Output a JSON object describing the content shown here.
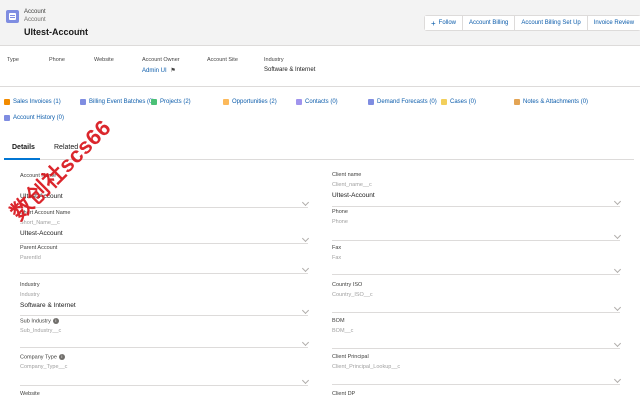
{
  "header": {
    "object_type": "Account",
    "object_type_sub": "Account",
    "record_name": "UItest-Account",
    "hierarchy_icon": "hierarchy-icon",
    "buttons": {
      "follow": "Follow",
      "account_billing": "Account Billing",
      "account_billing_setup": "Account Billing Set Up",
      "invoice_review": "Invoice Review"
    }
  },
  "highlights": {
    "type_label": "Type",
    "phone_label": "Phone",
    "website_label": "Website",
    "owner_label": "Account Owner",
    "owner_value": "Admin UI",
    "site_label": "Account Site",
    "industry_label": "Industry",
    "industry_value": "Software & Internet"
  },
  "related_links": [
    {
      "label": "Sales Invoices (1)",
      "color": "#f28b00"
    },
    {
      "label": "Billing Event Batches (0)",
      "color": "#7f8de1"
    },
    {
      "label": "Projects (2)",
      "color": "#4bc076"
    },
    {
      "label": "Opportunities (2)",
      "color": "#fcb95b"
    },
    {
      "label": "Contacts (0)",
      "color": "#a094ed"
    },
    {
      "label": "Demand Forecasts (0)",
      "color": "#7f8de1"
    },
    {
      "label": "Cases (0)",
      "color": "#f2cf5b"
    },
    {
      "label": "Notes & Attachments (0)",
      "color": "#e3a454"
    },
    {
      "label": "Account History (0)",
      "color": "#7f8de1"
    }
  ],
  "tabs": {
    "details": "Details",
    "related": "Related"
  },
  "fields_left": [
    {
      "label": "Account Name",
      "api": "",
      "value": "UItest-Account",
      "help": false
    },
    {
      "label": "Short Account Name",
      "api": "Short_Name__c",
      "value": "UItest-Account",
      "help": false
    },
    {
      "label": "Parent Account",
      "api": "ParentId",
      "value": "",
      "help": false
    },
    {
      "label": "Industry",
      "api": "Industry",
      "value": "Software & Internet",
      "help": false
    },
    {
      "label": "Sub Industry",
      "api": "Sub_Industry__c",
      "value": "",
      "help": true
    },
    {
      "label": "Company Type",
      "api": "Company_Type__c",
      "value": "",
      "help": true
    },
    {
      "label": "Website",
      "api": "",
      "value": "",
      "help": false
    }
  ],
  "fields_right": [
    {
      "label": "Client name",
      "api": "Client_name__c",
      "value": "UItest-Account",
      "help": false
    },
    {
      "label": "Phone",
      "api": "Phone",
      "value": "",
      "help": false
    },
    {
      "label": "Fax",
      "api": "Fax",
      "value": "",
      "help": false
    },
    {
      "label": "Country ISO",
      "api": "Country_ISO__c",
      "value": "",
      "help": false
    },
    {
      "label": "BOM",
      "api": "BOM__c",
      "value": "",
      "help": false
    },
    {
      "label": "Client Principal",
      "api": "Client_Principal_Lookup__c",
      "value": "",
      "help": false
    },
    {
      "label": "Client DP",
      "api": "",
      "value": "",
      "help": false
    }
  ],
  "watermark": "数创社scs66",
  "colors": {
    "link": "#0b5cab",
    "brand": "#0176d3",
    "watermark": "#d8141b"
  }
}
